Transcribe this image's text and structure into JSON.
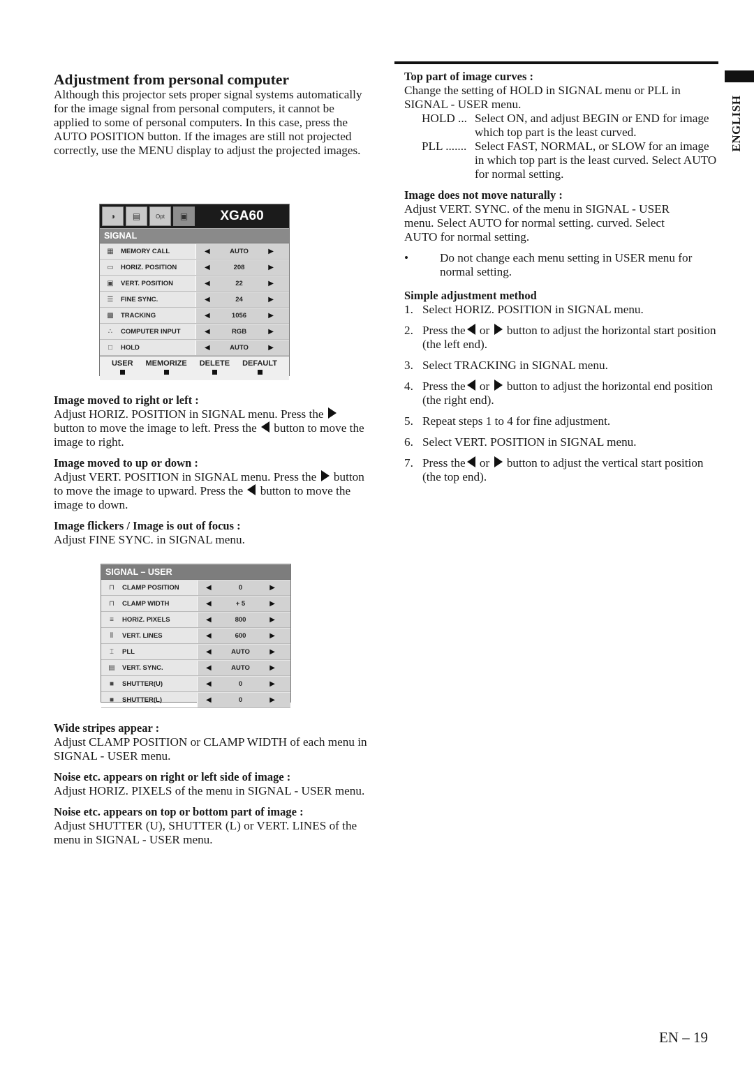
{
  "page": {
    "language_tab": "ENGLISH",
    "page_number": "EN – 19"
  },
  "left": {
    "title": "Adjustment from personal computer",
    "intro": "Although this projector sets proper signal systems automatically for the image signal from personal computers, it cannot be applied to some of personal computers.  In this case, press the AUTO POSITION button.  If the images are still not projected correctly, use the MENU display to adjust the projected images.",
    "sections": [
      {
        "heading": "Image moved to right or left :",
        "parts": [
          "Adjust HORIZ. POSITION in SIGNAL menu.  Press the ",
          "right",
          " button to move the image to left.  Press the ",
          "left",
          " button to move the image to right."
        ]
      },
      {
        "heading": "Image moved to up or down :",
        "parts": [
          "Adjust VERT. POSITION in SIGNAL menu.  Press the ",
          "right",
          " button to move the image to upward.  Press the ",
          "left",
          " button to move the image to down."
        ]
      },
      {
        "heading": "Image flickers / Image is out of focus :",
        "text": "Adjust FINE SYNC. in SIGNAL menu."
      }
    ],
    "sections2": [
      {
        "heading": "Wide stripes appear :",
        "text": "Adjust CLAMP POSITION or CLAMP WIDTH of each menu in SIGNAL - USER menu."
      },
      {
        "heading": "Noise etc. appears on right or left side of image :",
        "text": "Adjust HORIZ. PIXELS  of the menu in SIGNAL - USER menu."
      },
      {
        "heading": "Noise etc. appears on top or bottom part of image :",
        "text": "Adjust SHUTTER (U), SHUTTER (L) or VERT. LINES of the menu in SIGNAL - USER menu."
      }
    ]
  },
  "signal_menu": {
    "model": "XGA60",
    "tabs": [
      {
        "icon": "picture-adjust-icon",
        "glyph": "◑"
      },
      {
        "icon": "image-adjust-icon",
        "glyph": "▤"
      },
      {
        "icon": "option-icon",
        "glyph": "Opt"
      },
      {
        "icon": "signal-icon",
        "glyph": "▣"
      }
    ],
    "title": "SIGNAL",
    "rows": [
      {
        "label": "MEMORY CALL",
        "value": "AUTO",
        "icon": "memory-call-icon",
        "glyph": "▦"
      },
      {
        "label": "HORIZ. POSITION",
        "value": "208",
        "icon": "horiz-position-icon",
        "glyph": "▭"
      },
      {
        "label": "VERT. POSITION",
        "value": "22",
        "icon": "vert-position-icon",
        "glyph": "▣"
      },
      {
        "label": "FINE SYNC.",
        "value": "24",
        "icon": "fine-sync-icon",
        "glyph": "☰"
      },
      {
        "label": "TRACKING",
        "value": "1056",
        "icon": "tracking-icon",
        "glyph": "▩"
      },
      {
        "label": "COMPUTER INPUT",
        "value": "RGB",
        "icon": "computer-input-icon",
        "glyph": "∴"
      },
      {
        "label": "HOLD",
        "value": "AUTO",
        "icon": "hold-icon",
        "glyph": "□"
      }
    ],
    "bottom_buttons": [
      "USER",
      "MEMORIZE",
      "DELETE",
      "DEFAULT"
    ]
  },
  "signal_user_menu": {
    "title": "SIGNAL – USER",
    "rows": [
      {
        "label": "CLAMP POSITION",
        "value": "0",
        "icon": "clamp-position-icon",
        "glyph": "⊓"
      },
      {
        "label": "CLAMP WIDTH",
        "value": "+ 5",
        "icon": "clamp-width-icon",
        "glyph": "⊓"
      },
      {
        "label": "HORIZ. PIXELS",
        "value": "800",
        "icon": "horiz-pixels-icon",
        "glyph": "≡"
      },
      {
        "label": "VERT. LINES",
        "value": "600",
        "icon": "vert-lines-icon",
        "glyph": "⦀"
      },
      {
        "label": "PLL",
        "value": "AUTO",
        "icon": "pll-icon",
        "glyph": "⌶"
      },
      {
        "label": "VERT. SYNC.",
        "value": "AUTO",
        "icon": "vert-sync-icon",
        "glyph": "▤"
      },
      {
        "label": "SHUTTER(U)",
        "value": "0",
        "icon": "shutter-upper-icon",
        "glyph": "■"
      },
      {
        "label": "SHUTTER(L)",
        "value": "0",
        "icon": "shutter-lower-icon",
        "glyph": "■"
      }
    ]
  },
  "right": {
    "top_curves": {
      "heading": "Top part of image curves :",
      "text": "Change the setting of HOLD in SIGNAL menu or PLL in SIGNAL - USER menu.",
      "defs": [
        {
          "term": "HOLD ...",
          "desc": "Select ON, and adjust BEGIN or END for image which top part is the least curved."
        },
        {
          "term": "PLL .......",
          "desc": "Select FAST, NORMAL, or SLOW for an image in which top part is the least curved.  Select AUTO for normal setting."
        }
      ]
    },
    "not_natural": {
      "heading": "Image does not move naturally :",
      "text": "Adjust VERT. SYNC. of the menu in SIGNAL - USER menu.  Select AUTO for normal setting. curved.  Select AUTO for normal setting."
    },
    "bullet": {
      "mark": "•",
      "text": "Do not change each menu setting in USER menu for normal setting."
    },
    "simple": {
      "heading": "Simple adjustment method",
      "steps": [
        {
          "n": "1.",
          "parts": [
            "Select HORIZ. POSITION in SIGNAL menu."
          ]
        },
        {
          "n": "2.",
          "parts": [
            "Press the",
            "left",
            " or ",
            "right",
            " button to adjust the horizontal start position (the left end)."
          ]
        },
        {
          "n": "3.",
          "parts": [
            "Select TRACKING in SIGNAL menu."
          ]
        },
        {
          "n": "4.",
          "parts": [
            "Press the",
            "left",
            " or ",
            "right",
            " button to adjust the horizontal end position (the right end)."
          ]
        },
        {
          "n": "5.",
          "parts": [
            "Repeat steps 1 to 4 for fine adjustment."
          ]
        },
        {
          "n": "6.",
          "parts": [
            "Select VERT. POSITION in SIGNAL menu."
          ]
        },
        {
          "n": "7.",
          "parts": [
            "Press the",
            "left",
            " or ",
            "right",
            " button to adjust the vertical start position (the top end)."
          ]
        }
      ]
    }
  }
}
